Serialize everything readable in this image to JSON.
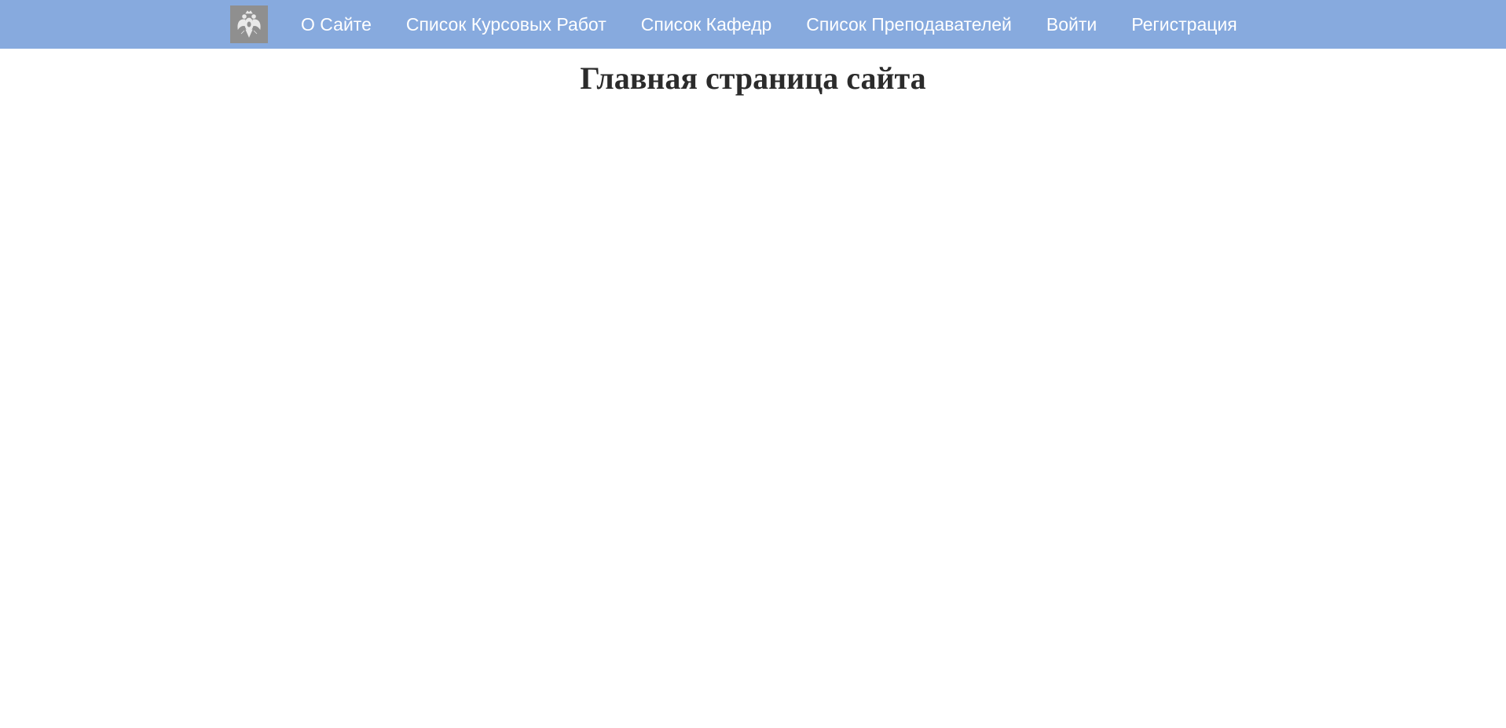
{
  "header": {
    "logo_icon": "double-headed-eagle-emblem-icon",
    "background_color": "#87aade",
    "nav": [
      {
        "label": "О Сайте"
      },
      {
        "label": "Список Курсовых Работ"
      },
      {
        "label": "Список Кафедр"
      },
      {
        "label": "Список Преподавателей"
      },
      {
        "label": "Войти"
      },
      {
        "label": "Регистрация"
      }
    ]
  },
  "main": {
    "title": "Главная страница сайта"
  }
}
